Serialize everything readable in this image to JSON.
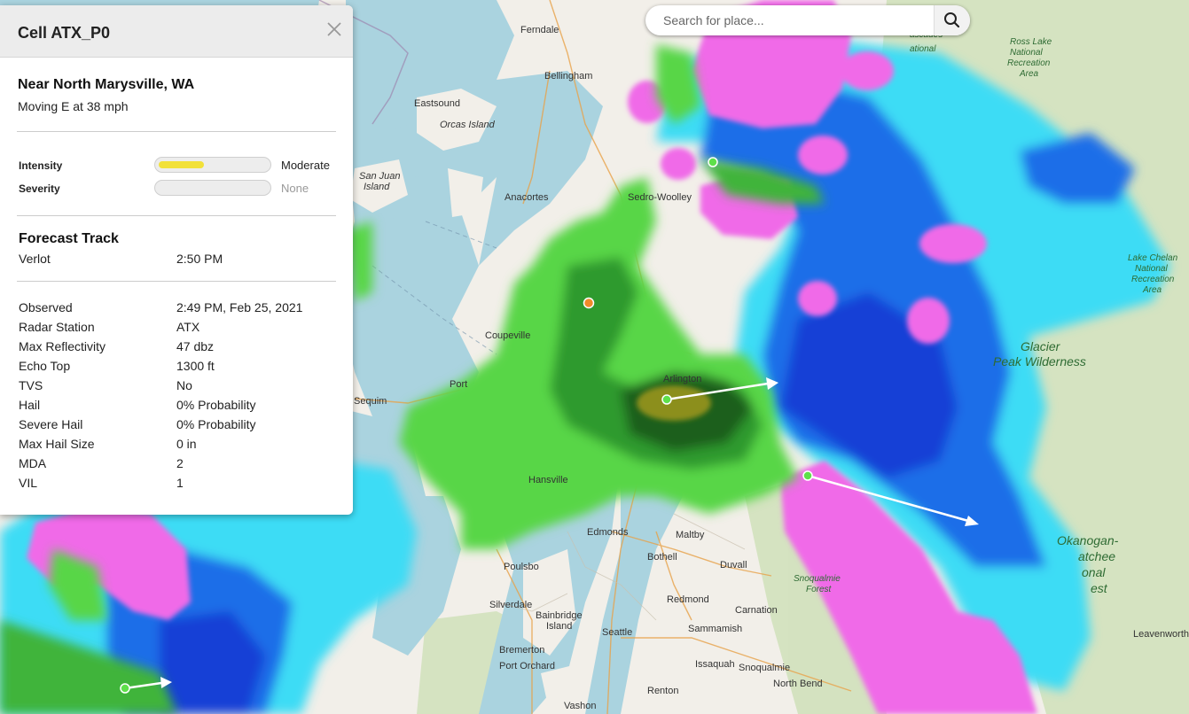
{
  "search": {
    "placeholder": "Search for place..."
  },
  "panel": {
    "title": "Cell ATX_P0",
    "location": "Near North Marysville, WA",
    "movement": "Moving E at 38 mph",
    "intensity": {
      "label": "Intensity",
      "value": "Moderate",
      "level": 0.42,
      "color": "#f2e13a"
    },
    "severity": {
      "label": "Severity",
      "value": "None",
      "level": 0
    },
    "forecast": {
      "title": "Forecast Track",
      "place": "Verlot",
      "time": "2:50 PM"
    },
    "details": [
      {
        "key": "Observed",
        "value": "2:49 PM, Feb 25, 2021"
      },
      {
        "key": "Radar Station",
        "value": "ATX"
      },
      {
        "key": "Max Reflectivity",
        "value": "47 dbz"
      },
      {
        "key": "Echo Top",
        "value": "1300 ft"
      },
      {
        "key": "TVS",
        "value": "No"
      },
      {
        "key": "Hail",
        "value": "0% Probability"
      },
      {
        "key": "Severe Hail",
        "value": "0% Probability"
      },
      {
        "key": "Max Hail Size",
        "value": "0 in"
      },
      {
        "key": "MDA",
        "value": "2"
      },
      {
        "key": "VIL",
        "value": "1"
      }
    ]
  },
  "map": {
    "places": [
      "Ferndale",
      "Bellingham",
      "Eastsound",
      "Orcas Island",
      "San Juan Island",
      "Anacortes",
      "Sedro-Woolley",
      "Coupeville",
      "Arlington",
      "Sequim",
      "Port",
      "Hansville",
      "Edmonds",
      "Maltby",
      "Bothell",
      "Duvall",
      "Poulsbo",
      "Redmond",
      "Carnation",
      "Silverdale",
      "Bainbridge Island",
      "Seattle",
      "Sammamish",
      "Bremerton",
      "Port Orchard",
      "Issaquah",
      "Snoqualmie",
      "North Bend",
      "Renton",
      "Vashon",
      "Leavenworth",
      "Snoqualmie Forest"
    ],
    "parks": [
      "Ross Lake National Recreation Area",
      "Lake Chelan National Recreation Area",
      "Glacier Peak Wilderness",
      "Okanogan-Wenatchee National Forest",
      "Cascades National"
    ],
    "colors": {
      "water": "#aad3df",
      "land": "#f2efe9",
      "rain_light": "#5ee04a",
      "rain_dark": "#1e6b1e",
      "snow_light": "#3cdcf5",
      "snow_dark": "#1a52e0",
      "mix": "#f06be8"
    }
  }
}
